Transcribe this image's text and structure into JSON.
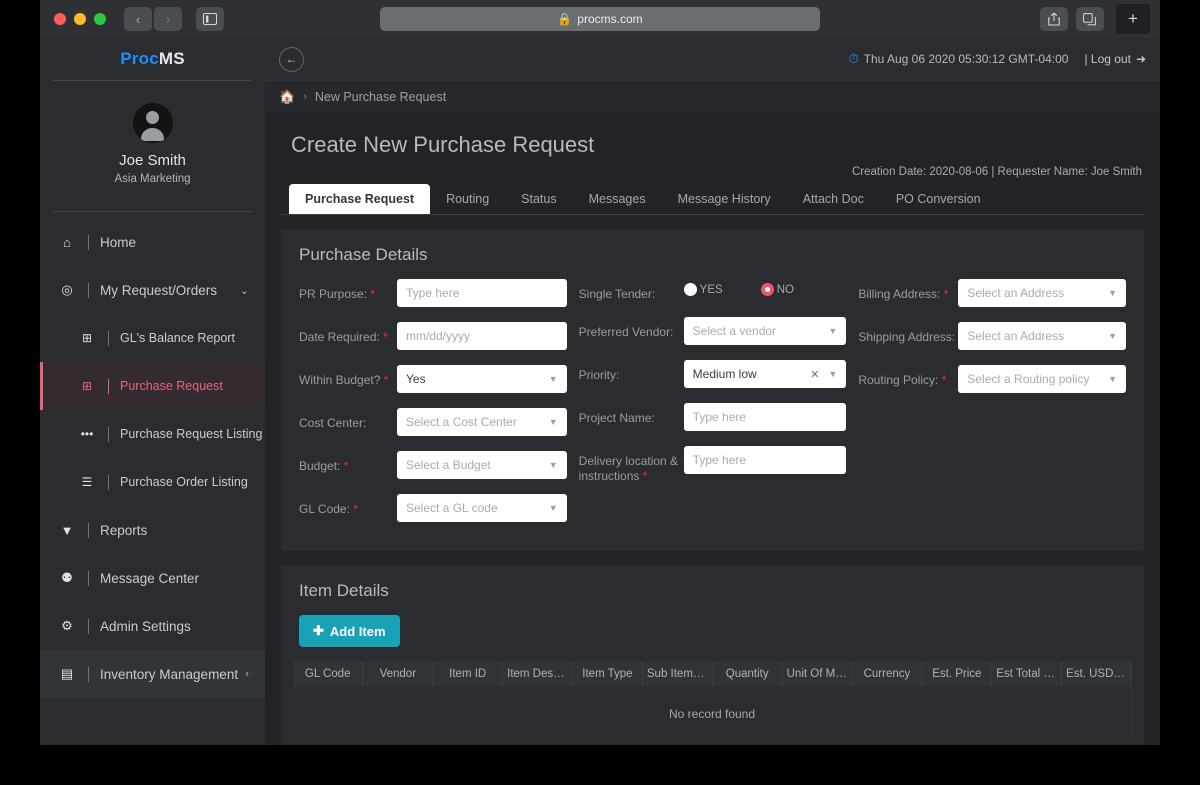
{
  "browser": {
    "url": "procms.com",
    "lock_icon": "lock-icon",
    "back_icon": "‹",
    "forward_icon": "›",
    "sidebar_icon": "sidebar-icon",
    "share_icon": "share-icon",
    "tabs_icon": "tabs-icon",
    "newtab_icon": "+"
  },
  "sidebar": {
    "brand_primary": "Proc",
    "brand_secondary": "MS",
    "user_name": "Joe Smith",
    "user_dept": "Asia Marketing",
    "items": [
      {
        "label": "Home",
        "icon": "home-icon",
        "glyph": "⌂",
        "level": "top",
        "state": "normal",
        "chevron": ""
      },
      {
        "label": "My Request/Orders",
        "icon": "target-icon",
        "glyph": "◎",
        "level": "top",
        "state": "normal",
        "chevron": "⌄"
      },
      {
        "label": "GL's Balance Report",
        "icon": "plus-square-icon",
        "glyph": "⊞",
        "level": "sub",
        "state": "normal",
        "chevron": ""
      },
      {
        "label": "Purchase Request",
        "icon": "plus-square-icon",
        "glyph": "⊞",
        "level": "sub",
        "state": "active",
        "chevron": ""
      },
      {
        "label": "Purchase Request Listing",
        "icon": "ellipsis-icon",
        "glyph": "•••",
        "level": "sub",
        "state": "normal",
        "chevron": ""
      },
      {
        "label": "Purchase Order Listing",
        "icon": "list-icon",
        "glyph": "☰",
        "level": "sub",
        "state": "normal",
        "chevron": ""
      },
      {
        "label": "Reports",
        "icon": "filter-icon",
        "glyph": "▼",
        "level": "top",
        "state": "normal",
        "chevron": ""
      },
      {
        "label": "Message Center",
        "icon": "chat-icon",
        "glyph": "⚉",
        "level": "top",
        "state": "normal",
        "chevron": ""
      },
      {
        "label": "Admin Settings",
        "icon": "gears-icon",
        "glyph": "⚙",
        "level": "top",
        "state": "normal",
        "chevron": ""
      },
      {
        "label": "Inventory Management",
        "icon": "building-icon",
        "glyph": "▤",
        "level": "top",
        "state": "highlight",
        "chevron": "‹"
      }
    ]
  },
  "topbar": {
    "back_icon": "arrow-left-icon",
    "back_glyph": "←",
    "clock_icon": "clock-icon",
    "datetime": "Thu Aug 06 2020 05:30:12 GMT-04:00",
    "logout_label": "| Log out",
    "logout_icon": "sign-out-icon"
  },
  "breadcrumb": {
    "home_icon": "home-icon",
    "separator": "›",
    "current": "New Purchase Request"
  },
  "page": {
    "title": "Create New Purchase Request",
    "creation_info": "Creation Date: 2020-08-06 | Requester Name: Joe Smith"
  },
  "tabs": [
    {
      "label": "Purchase Request",
      "active": true
    },
    {
      "label": "Routing",
      "active": false
    },
    {
      "label": "Status",
      "active": false
    },
    {
      "label": "Messages",
      "active": false
    },
    {
      "label": "Message History",
      "active": false
    },
    {
      "label": "Attach Doc",
      "active": false
    },
    {
      "label": "PO Conversion",
      "active": false
    }
  ],
  "purchase_details": {
    "section_title": "Purchase Details",
    "column1": [
      {
        "label": "PR Purpose:",
        "required": true,
        "type": "input",
        "value": "",
        "placeholder": "Type here"
      },
      {
        "label": "Date Required:",
        "required": true,
        "type": "input",
        "value": "",
        "placeholder": "mm/dd/yyyy"
      },
      {
        "label": "Within Budget?",
        "required": true,
        "type": "select",
        "value": "Yes",
        "placeholder": ""
      },
      {
        "label": "Cost Center:",
        "required": false,
        "type": "select",
        "value": "",
        "placeholder": "Select a Cost Center"
      },
      {
        "label": "Budget:",
        "required": true,
        "type": "select",
        "value": "",
        "placeholder": "Select a Budget"
      },
      {
        "label": "GL Code:",
        "required": true,
        "type": "select",
        "value": "",
        "placeholder": "Select a GL code"
      }
    ],
    "single_tender": {
      "label": "Single Tender:",
      "options": [
        {
          "label": "YES",
          "selected": false
        },
        {
          "label": "NO",
          "selected": true
        }
      ]
    },
    "column2": [
      {
        "label": "Preferred Vendor:",
        "required": false,
        "type": "select",
        "value": "",
        "placeholder": "Select a vendor"
      },
      {
        "label": "Priority:",
        "required": false,
        "type": "select-clearable",
        "value": "Medium low",
        "placeholder": ""
      },
      {
        "label": "Project Name:",
        "required": false,
        "type": "input",
        "value": "",
        "placeholder": "Type here"
      },
      {
        "label": "Delivery location & instructions",
        "required": true,
        "type": "input",
        "value": "",
        "placeholder": "Type here"
      }
    ],
    "column3": [
      {
        "label": "Billing Address:",
        "required": true,
        "type": "select",
        "value": "",
        "placeholder": "Select an Address"
      },
      {
        "label": "Shipping Address:",
        "required": false,
        "type": "select",
        "value": "",
        "placeholder": "Select an Address"
      },
      {
        "label": "Routing Policy:",
        "required": true,
        "type": "select",
        "value": "",
        "placeholder": "Select a Routing policy"
      }
    ]
  },
  "item_details": {
    "section_title": "Item Details",
    "add_button": "Add Item",
    "add_icon": "plus-icon",
    "columns": [
      "GL Code",
      "Vendor",
      "Item ID",
      "Item Description",
      "Item Type",
      "Sub Item-T...",
      "Quantity",
      "Unit Of Measure",
      "Currency",
      "Est. Price",
      "Est Total Price",
      "Est. USD To"
    ],
    "empty_message": "No record found"
  },
  "colors": {
    "accent_blue": "#1e8fff",
    "accent_pink": "#e8647a",
    "required_red": "#ff2a2a",
    "teal_button": "#17a2b8",
    "panel_bg": "#2a2c30",
    "content_bg": "#212327"
  }
}
